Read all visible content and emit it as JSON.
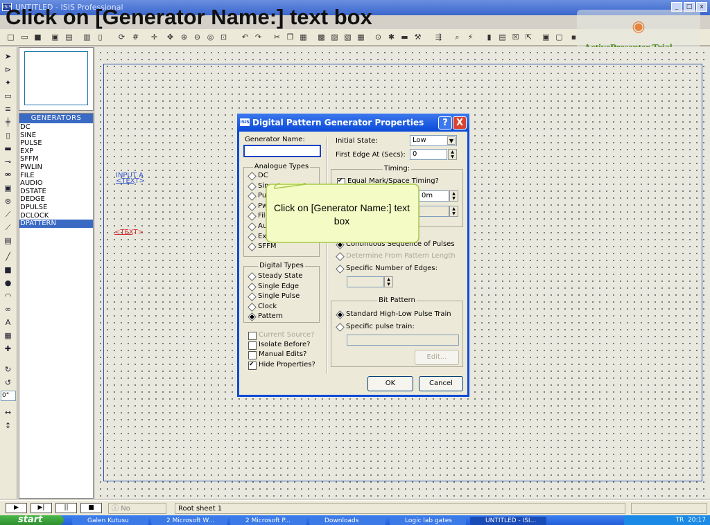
{
  "window": {
    "app_title": "UNTITLED - ISIS Professional",
    "overlay_title": "Click on [Generator Name:] text box",
    "logo_text": "ISIS",
    "min_label": "_",
    "max_label": "□",
    "close_label": "x"
  },
  "watermark": {
    "text": "ActivePresenter Trial"
  },
  "generators": {
    "header": "GENERATORS",
    "items": [
      "DC",
      "SINE",
      "PULSE",
      "EXP",
      "SFFM",
      "PWLIN",
      "FILE",
      "AUDIO",
      "DSTATE",
      "DEDGE",
      "DPULSE",
      "DCLOCK",
      "DPATTERN"
    ],
    "selected": "DPATTERN"
  },
  "canvas": {
    "component1_label": "INPUT A",
    "component1_text": "<TEXT>",
    "component2_text": "<TEXT>"
  },
  "left_tools": {
    "angle_value": "0°"
  },
  "dialog": {
    "title": "Digital Pattern Generator Properties",
    "logo": "ISIS",
    "help_label": "?",
    "close_label": "X",
    "generator_name_label": "Generator Name:",
    "generator_name_value": "",
    "analog_types_title": "Analogue Types",
    "analog_types": [
      "DC",
      "Sine",
      "Pulse",
      "Pwlin",
      "File",
      "Audio",
      "Exp",
      "SFFM"
    ],
    "digital_types_title": "Digital Types",
    "digital_types": [
      "Steady State",
      "Single Edge",
      "Single Pulse",
      "Clock",
      "Pattern"
    ],
    "digital_selected": "Pattern",
    "checks": {
      "current_source": "Current Source?",
      "isolate_before": "Isolate Before?",
      "manual_edits": "Manual Edits?",
      "hide_properties": "Hide Properties?"
    },
    "initial_state_label": "Initial State:",
    "initial_state_value": "Low",
    "first_edge_label": "First Edge At (Secs):",
    "first_edge_value": "0",
    "timing_title": "Timing:",
    "equal_mark_space": "Equal Mark/Space Timing?",
    "pulse_width_value": "0m",
    "continuous_sequence": "Continuous Sequence of Pulses",
    "determine_from_pattern": "Determine From Pattern Length",
    "specific_edges": "Specific Number of Edges:",
    "bit_pattern_title": "Bit Pattern",
    "standard_pulse_train": "Standard High-Low Pulse Train",
    "specific_pulse_train": "Specific pulse train:",
    "edit_button": "Edit...",
    "ok_button": "OK",
    "cancel_button": "Cancel"
  },
  "callout": {
    "text": "Click on [Generator Name:] text box"
  },
  "statusbar": {
    "messages": "No Messages",
    "sheet": "Root sheet 1"
  },
  "taskbar": {
    "start": "start",
    "tasks": [
      "Galen Kutusu",
      "2 Microsoft W...",
      "2 Microsoft P...",
      "Downloads",
      "Logic lab gates",
      "UNTITLED - ISI..."
    ],
    "tray_time": "20:17",
    "tray_label": "TR"
  },
  "colors": {
    "dialog_border": "#0a4ad8",
    "selection": "#3a6ac4",
    "callout_fill": "#f4fbc4",
    "callout_border": "#a6c94a",
    "watermark_text": "#4f8f1d"
  }
}
